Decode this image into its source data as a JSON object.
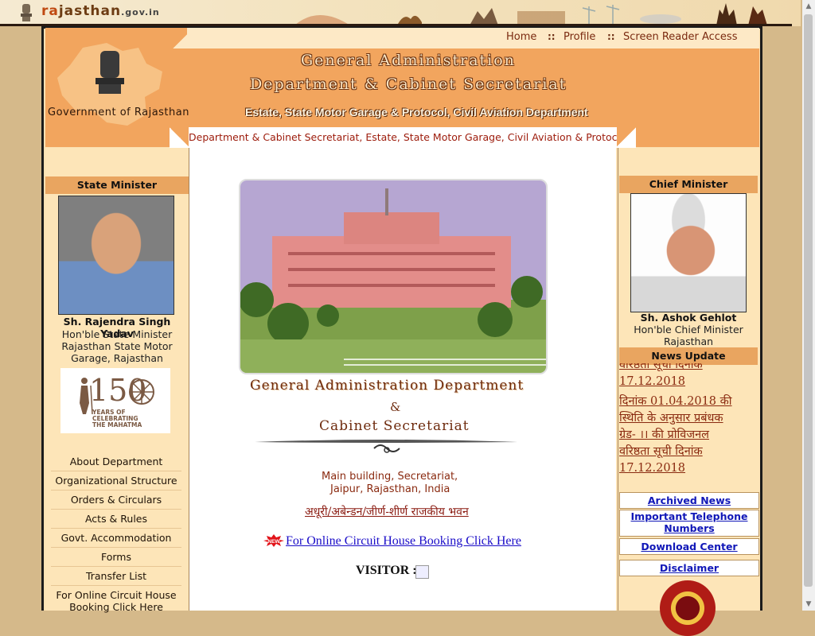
{
  "portal": {
    "logo_prefix": "ra",
    "logo_mid": "jasthan",
    "domain": ".gov.in"
  },
  "header": {
    "nav": [
      "Home",
      "Profile",
      "Screen Reader Access"
    ],
    "separator": "::",
    "govt_label": "Government of Rajasthan",
    "title_line1": "General Administration",
    "title_line2": "Department & Cabinet Secretariat",
    "title_line3": "Estate, State Motor Garage & Protocol, Civil Aviation Department",
    "marquee": "Department & Cabinet Secretariat, Estate, State Motor Garage, Civil Aviation & Protocol Depa"
  },
  "left": {
    "heading": "State Minister",
    "name": "Sh. Rajendra Singh Yadav",
    "role_lines": [
      "Hon'ble State Minister",
      "Rajasthan State Motor",
      "Garage, Rajasthan"
    ],
    "badge_number": "150",
    "badge_caption": [
      "YEARS OF",
      "CELEBRATING",
      "THE MAHATMA"
    ],
    "nav": [
      "About Department",
      "Organizational Structure",
      "Orders & Circulars",
      "Acts & Rules",
      "Govt. Accommodation",
      "Forms",
      "Transfer List",
      "For Online Circuit House Booking Click Here"
    ]
  },
  "center": {
    "title1": "General Administration Department",
    "amp": "&",
    "title2": "Cabinet Secretariat",
    "address1": "Main building, Secretariat,",
    "address2": "Jaipur, Rajasthan, India",
    "hindi_link": "अधूरी/अबेन्डन/जीर्ण-शीर्ण राजकीय भवन",
    "new_badge": "NEW",
    "booking_link": "For Online Circuit House Booking Click Here",
    "visitor_label": "VISITOR :"
  },
  "right": {
    "heading": "Chief Minister",
    "name": "Sh. Ashok Gehlot",
    "role_lines": [
      "Hon'ble Chief Minister",
      "Rajasthan"
    ],
    "news_heading": "News Update",
    "news_lines": [
      "वरिष्ठता सूची दिनांक",
      "17.12.2018",
      "दिनांक 01.04.2018 की",
      "स्थिति के अनुसार प्रबंधक",
      "ग्रेड- ।। की प्रोविजनल",
      "वरिष्ठता सूची दिनांक",
      "17.12.2018"
    ],
    "links": [
      "Archived News",
      "Important Telephone Numbers",
      "Download Center",
      "Disclaimer"
    ]
  },
  "colors": {
    "header_orange": "#f2a55e",
    "panel_cream": "#fde5b8",
    "link_blue": "#1118b8",
    "maroon_text": "#8a2a10"
  }
}
